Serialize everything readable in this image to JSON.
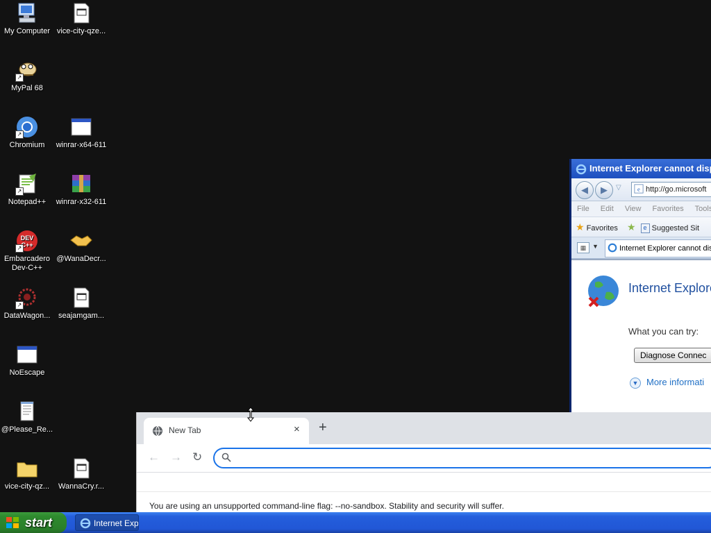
{
  "desktop": {
    "icons": [
      {
        "label": "My Computer",
        "icon": "computer-icon"
      },
      {
        "label": "vice-city-qze...",
        "icon": "file-icon"
      },
      {
        "label": "MyPal 68",
        "icon": "mypal-icon"
      },
      {
        "label": "Chromium",
        "icon": "chromium-icon"
      },
      {
        "label": "winrar-x64-611",
        "icon": "window-icon"
      },
      {
        "label": "Notepad++",
        "icon": "notepadpp-icon"
      },
      {
        "label": "winrar-x32-611",
        "icon": "winrar-icon"
      },
      {
        "label": "Embarcadero Dev-C++",
        "icon": "devcpp-icon"
      },
      {
        "label": "@WanaDecr...",
        "icon": "handshake-icon"
      },
      {
        "label": "DataWagon...",
        "icon": "datawagon-icon"
      },
      {
        "label": "seajamgam...",
        "icon": "file-icon"
      },
      {
        "label": "NoEscape",
        "icon": "window-icon"
      },
      {
        "label": "@Please_Re...",
        "icon": "notepad-icon"
      },
      {
        "label": "vice-city-qz...",
        "icon": "folder-icon"
      },
      {
        "label": "WannaCry.r...",
        "icon": "file-icon"
      }
    ]
  },
  "ie": {
    "title": "Internet Explorer cannot disp",
    "address": "http://go.microsoft",
    "menu": [
      "File",
      "Edit",
      "View",
      "Favorites",
      "Tools"
    ],
    "favorites_label": "Favorites",
    "suggested_label": "Suggested Sit",
    "tab_label": "Internet Explorer cannot dis",
    "error_title": "Internet Explore",
    "what_you_can_try": "What you can try:",
    "diagnose_button": "Diagnose Connec",
    "more_info": "More informati"
  },
  "chromium": {
    "tab_title": "New Tab",
    "new_tab_symbol": "+",
    "close_symbol": "×",
    "back_symbol": "←",
    "forward_symbol": "→",
    "reload_symbol": "↻",
    "info_bar": "You are using an unsupported command-line flag: --no-sandbox. Stability and security will suffer."
  },
  "taskbar": {
    "start_label": "start",
    "item_label": "Internet Expl"
  },
  "colors": {
    "desktop_bg": "#121212",
    "taskbar": "#245edc",
    "start_green": "#2e8b2e",
    "omnibox_focus": "#1a73e8"
  }
}
